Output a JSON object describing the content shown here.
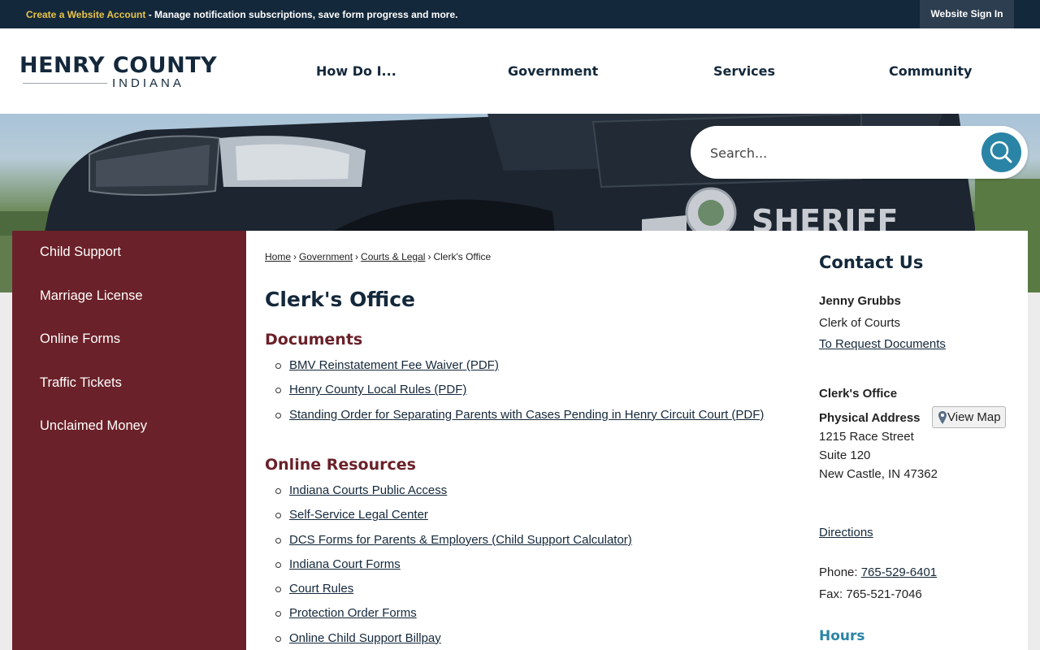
{
  "topbar": {
    "account_link": "Create a Website Account",
    "message": " - Manage notification subscriptions, save form progress and more.",
    "sign_in": "Website Sign In"
  },
  "logo": {
    "main": "HENRY COUNTY",
    "sub": "INDIANA"
  },
  "nav": [
    "How Do I...",
    "Government",
    "Services",
    "Community"
  ],
  "hero": {
    "vehicle_text": "SHERIFF"
  },
  "search": {
    "placeholder": "Search..."
  },
  "sidebar": {
    "items": [
      {
        "label": "Child Support"
      },
      {
        "label": "Marriage License"
      },
      {
        "label": "Online Forms"
      },
      {
        "label": "Traffic Tickets"
      },
      {
        "label": "Unclaimed Money"
      }
    ]
  },
  "breadcrumb": {
    "home": "Home",
    "government": "Government",
    "courts": "Courts & Legal",
    "current": "Clerk's Office",
    "separator": "›"
  },
  "page": {
    "title": "Clerk's Office",
    "documents": {
      "heading": "Documents",
      "links": [
        "BMV Reinstatement Fee Waiver (PDF)",
        "Henry County Local Rules (PDF)",
        "Standing Order for Separating Parents with Cases Pending in Henry Circuit Court (PDF)"
      ]
    },
    "resources": {
      "heading": "Online Resources",
      "links": [
        "Indiana Courts Public Access",
        "Self-Service Legal Center",
        "DCS Forms for Parents & Employers (Child Support Calculator)",
        "Indiana Court Forms",
        "Court Rules",
        "Protection Order Forms",
        "Online Child Support Billpay"
      ]
    }
  },
  "contact": {
    "title": "Contact Us",
    "name": "Jenny Grubbs",
    "role": "Clerk of Courts",
    "request_link": "To Request Documents",
    "office": "Clerk's Office",
    "physical_label": "Physical Address",
    "view_map": "View Map",
    "address1": "1215 Race Street",
    "address2": "Suite 120",
    "address3": "New Castle, IN 47362",
    "directions": "Directions",
    "phone_label": "Phone: ",
    "phone": "765-529-6401",
    "fax": "Fax: 765-521-7046",
    "hours_heading": "Hours"
  },
  "colors": {
    "navy": "#14283b",
    "maroon": "#6b2129",
    "teal": "#2a84a5",
    "accent_yellow": "#e8c547"
  },
  "icons": {
    "search": "search-icon",
    "map_pin": "map-pin-icon"
  }
}
